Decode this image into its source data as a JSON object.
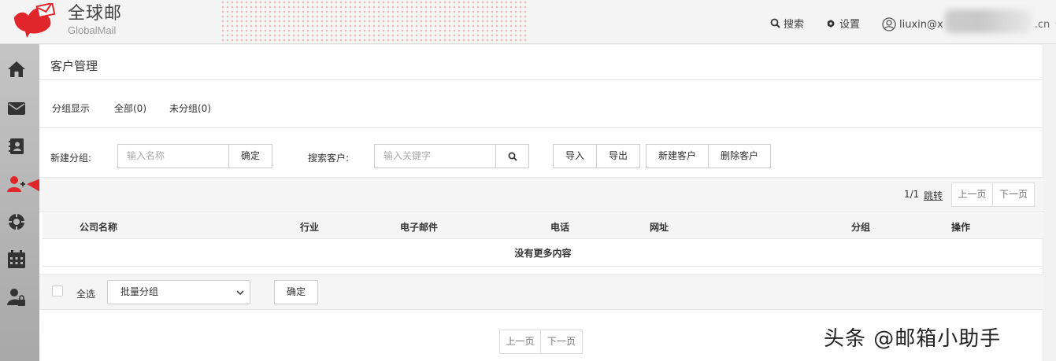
{
  "header": {
    "logo_cn": "全球邮",
    "logo_en": "GlobalMail",
    "search_label": "搜索",
    "settings_label": "设置",
    "user_prefix": "liuxin@x",
    "user_suffix": ".cn"
  },
  "sidebar": {
    "items": [
      {
        "icon": "home-icon"
      },
      {
        "icon": "mail-icon"
      },
      {
        "icon": "contacts-book-icon"
      },
      {
        "icon": "add-customer-icon",
        "active": true
      },
      {
        "icon": "compass-icon"
      },
      {
        "icon": "calendar-icon"
      },
      {
        "icon": "user-lock-icon"
      }
    ]
  },
  "panel": {
    "title": "客户管理",
    "group_display": "分组显示",
    "all_groups": "全部(0)",
    "ungrouped": "未分组(0)",
    "new_group_label": "新建分组:",
    "new_group_placeholder": "输入名称",
    "confirm": "确定",
    "search_label": "搜索客户:",
    "search_placeholder": "输入关键字",
    "import": "导入",
    "export": "导出",
    "new_customer": "新建客户",
    "delete_customer": "删除客户"
  },
  "pager": {
    "page_info": "1/1",
    "jump": "跳转",
    "prev": "上一页",
    "next": "下一页"
  },
  "table": {
    "columns": [
      "公司名称",
      "行业",
      "电子邮件",
      "电话",
      "网址",
      "分组",
      "操作"
    ],
    "empty_text": "没有更多内容"
  },
  "footer": {
    "select_all": "全选",
    "batch_group": "批量分组",
    "confirm": "确定",
    "prev": "上一页",
    "next": "下一页"
  },
  "watermark": "头条 @邮箱小助手",
  "colors": {
    "accent_red": "#e0262b",
    "border": "#cccccc"
  }
}
